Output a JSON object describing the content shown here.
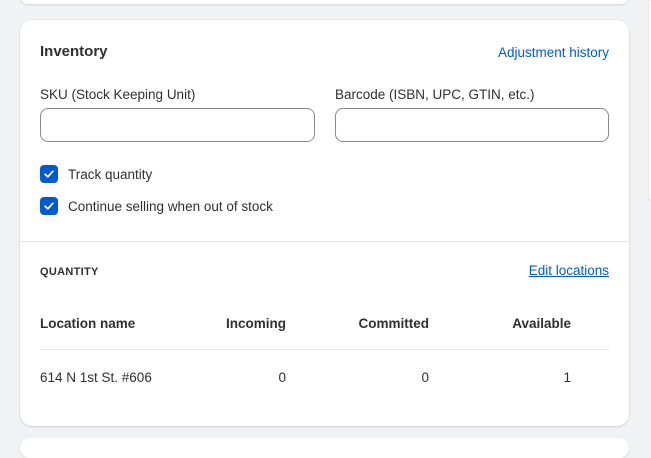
{
  "inventory": {
    "title": "Inventory",
    "adjustment_history_link": "Adjustment history",
    "sku": {
      "label": "SKU (Stock Keeping Unit)",
      "value": "",
      "placeholder": ""
    },
    "barcode": {
      "label": "Barcode (ISBN, UPC, GTIN, etc.)",
      "value": "",
      "placeholder": ""
    },
    "track_quantity": {
      "label": "Track quantity",
      "checked": true
    },
    "continue_selling": {
      "label": "Continue selling when out of stock",
      "checked": true
    }
  },
  "quantity": {
    "heading": "QUANTITY",
    "edit_locations_link": "Edit locations",
    "columns": {
      "location": "Location name",
      "incoming": "Incoming",
      "committed": "Committed",
      "available": "Available"
    },
    "rows": [
      {
        "location": "614 N 1st St. #606",
        "incoming": "0",
        "committed": "0",
        "available": "1"
      }
    ]
  },
  "colors": {
    "accent": "#005bd3",
    "text": "#303030",
    "border": "#e3e3e3",
    "background": "#f1f2f4"
  },
  "icons": {
    "checkbox_mark": "checkmark-icon"
  }
}
